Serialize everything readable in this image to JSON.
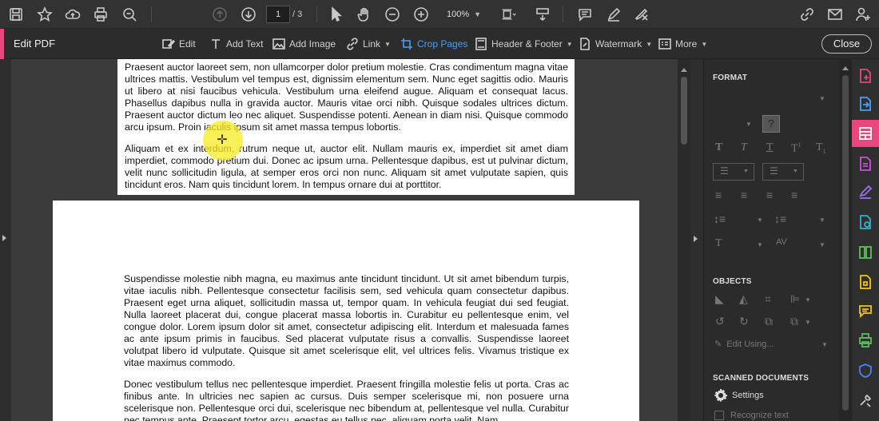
{
  "toolbar": {
    "page_current": "1",
    "page_total": "/ 3",
    "zoom": "100%"
  },
  "editbar": {
    "title": "Edit PDF",
    "tools": [
      "Edit",
      "Add Text",
      "Add Image",
      "Link",
      "Crop Pages",
      "Header & Footer",
      "Watermark",
      "More"
    ],
    "close_label": "Close"
  },
  "document": {
    "page1_paragraphs": [
      "Praesent auctor laoreet sem, non ullamcorper dolor pretium molestie. Cras condimentum magna vitae ultrices mattis. Vestibulum vel tempus est, dignissim elementum sem. Nunc eget sagittis odio. Mauris ut libero at nisi faucibus vehicula. Vestibulum urna eleifend augue. Aliquam et consequat lacus. Phasellus dapibus nulla in gravida auctor. Mauris vitae orci nibh. Quisque sodales ultrices dictum. Praesent auctor dictum leo nec aliquet. Suspendisse potenti. Aenean in diam nisi. Quisque commodo arcu ipsum. Proin iaculis ipsum sit amet massa tempus lobortis.",
      "Aliquam et ex interdum, rutrum neque ut, auctor elit. Nullam mauris ex, imperdiet sit amet diam imperdiet, commodo pretium dui. Donec ac ipsum urna. Pellentesque dapibus, est ut pulvinar dictum, velit nunc sollicitudin ligula, at semper eros orci non nunc. Aliquam sit amet vulputate sapien, quis tincidunt eros. Nam quis tincidunt lorem. In tempus ornare dui at porttitor."
    ],
    "page2_paragraphs": [
      "Suspendisse molestie nibh magna, eu maximus ante tincidunt tincidunt. Ut sit amet bibendum turpis, vitae iaculis nibh. Pellentesque consectetur facilisis sem, sed vehicula quam consectetur dapibus. Praesent eget urna aliquet, sollicitudin massa ut, tempor quam. In vehicula feugiat dui sed feugiat. Nulla laoreet placerat dui, congue placerat massa lobortis in. Curabitur eu pellentesque enim, vel congue dolor. Lorem ipsum dolor sit amet, consectetur adipiscing elit. Interdum et malesuada fames ac ante ipsum primis in faucibus. Sed placerat vulputate risus a convallis. Suspendisse laoreet volutpat libero id vulputate. Quisque sit amet scelerisque elit, vel ultrices felis. Vivamus tristique ex vitae maximus commodo.",
      "Donec vestibulum tellus nec pellentesque imperdiet. Praesent fringilla molestie felis ut porta. Cras ac finibus ante. In ultricies nec sapien ac cursus. Duis semper scelerisque mi, non posuere urna scelerisque non. Pellentesque orci dui, scelerisque nec bibendum at, pellentesque vel nulla. Curabitur nec tempus ante. Praesent tortor arcu, egestas eu tellus nec, aliquam porta velit. Nam"
    ]
  },
  "panel": {
    "format_header": "FORMAT",
    "objects_header": "OBJECTS",
    "edit_using": "Edit Using...",
    "scanned_header": "SCANNED DOCUMENTS",
    "settings_label": "Settings",
    "recognize_label": "Recognize text"
  },
  "colors": {
    "accent": "#e8467c",
    "active_tool": "#4a9ff5"
  }
}
